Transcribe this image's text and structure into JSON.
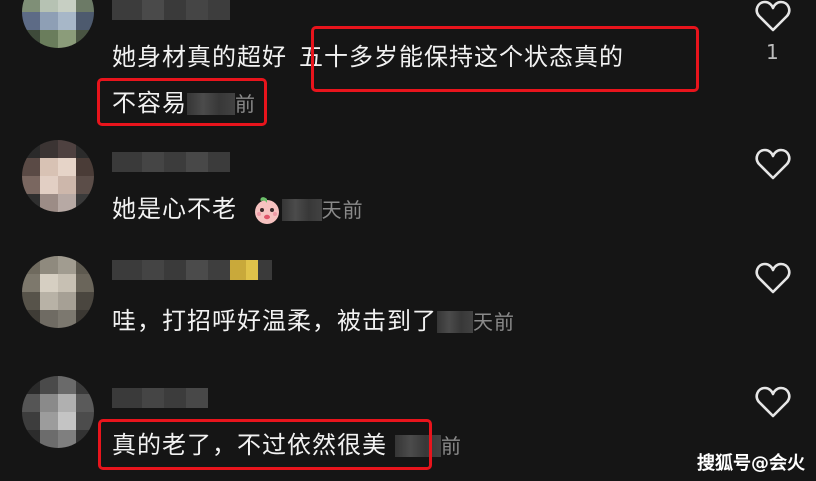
{
  "comments": [
    {
      "text_plain": "她身材真的超好",
      "text_hl1": "五十多岁能保持这个状态真的",
      "text_hl2": "不容易",
      "time_suffix": "前",
      "likes": "1"
    },
    {
      "text_plain": "她是心不老",
      "emoji": "peach-face-emoji",
      "time_suffix": "天前",
      "likes": ""
    },
    {
      "text_plain": "哇，打招呼好温柔，被击到了",
      "time_suffix": "天前",
      "likes": ""
    },
    {
      "text_plain": "真的老了，不过依然很美",
      "time_suffix": "前",
      "likes": ""
    }
  ],
  "icons": {
    "like": "heart-outline-icon"
  },
  "colors": {
    "background": "#151515",
    "highlight": "#e8141c",
    "text": "#f2f2f2",
    "muted": "#8a8a8a"
  },
  "watermark": "搜狐号@会火"
}
